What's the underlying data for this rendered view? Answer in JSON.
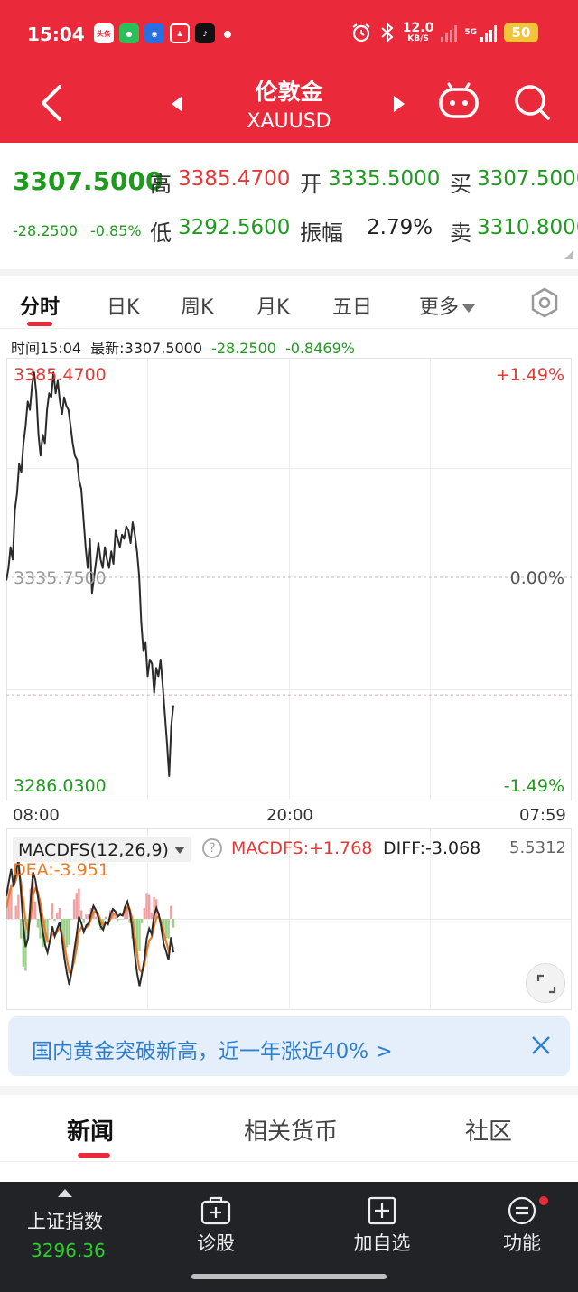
{
  "status": {
    "time": "15:04",
    "net_speed_value": "12.0",
    "net_speed_unit": "KB/S",
    "network": "5G",
    "battery": "50",
    "notif_icons": [
      "toutiao-icon",
      "message-icon",
      "bird-app-icon",
      "qq-icon",
      "tiktok-icon"
    ],
    "notif_toutiao_text": "头条"
  },
  "header": {
    "title": "伦敦金",
    "symbol": "XAUUSD"
  },
  "quote": {
    "price": "3307.5000",
    "change": "-28.2500",
    "change_pct": "-0.85%",
    "high_label": "高",
    "high": "3385.4700",
    "low_label": "低",
    "low": "3292.5600",
    "open_label": "开",
    "open": "3335.5000",
    "amp_label": "振幅",
    "amp": "2.79%",
    "buy_label": "买",
    "buy": "3307.5000",
    "sell_label": "卖",
    "sell": "3310.8000"
  },
  "tabs": {
    "items": [
      "分时",
      "日K",
      "周K",
      "月K",
      "五日"
    ],
    "more": "更多",
    "active": "分时"
  },
  "chart_info": {
    "time": "时间15:04",
    "latest": "最新:3307.5000",
    "change": "-28.2500",
    "change_pct": "-0.8469%"
  },
  "chart_data": {
    "type": "line",
    "ylim": [
      3286.03,
      3385.47
    ],
    "y_left_labels": {
      "top": "3385.4700",
      "mid": "3335.7500",
      "bottom": "3286.0300"
    },
    "y_right_labels": {
      "top": "+1.49%",
      "mid": "0.00%",
      "bottom": "-1.49%"
    },
    "x_labels": [
      "08:00",
      "20:00",
      "07:59"
    ],
    "reference": 3335.75,
    "current": 3307.5,
    "series": [
      {
        "values": [
          3335,
          3338,
          3343,
          3340,
          3352,
          3356,
          3363,
          3361,
          3368,
          3372,
          3378,
          3376,
          3382,
          3385,
          3380,
          3370,
          3365,
          3370,
          3368,
          3376,
          3380,
          3379,
          3385,
          3380,
          3383,
          3378,
          3375,
          3379,
          3377,
          3376,
          3372,
          3368,
          3365,
          3364,
          3359,
          3357,
          3350,
          3343,
          3338,
          3345,
          3332,
          3336,
          3340,
          3344,
          3340,
          3338,
          3343,
          3340,
          3338,
          3342,
          3339,
          3347,
          3345,
          3343,
          3346,
          3345,
          3348,
          3347,
          3344,
          3349,
          3346,
          3342,
          3336,
          3325,
          3318,
          3320,
          3312,
          3316,
          3315,
          3308,
          3314,
          3312,
          3316,
          3310,
          3303,
          3296,
          3288,
          3300,
          3305
        ]
      }
    ]
  },
  "macd": {
    "label": "MACDFS(12,26,9)",
    "macdfs": "MACDFS:+1.768",
    "diff": "DIFF:-3.068",
    "dea": "DEA:-3.951",
    "scale_max": "5.5312",
    "diff_series": [
      2.1,
      3.4,
      4.6,
      3.0,
      4.2,
      5.5,
      2.6,
      -0.6,
      -2.6,
      -1.8,
      1.6,
      4.3,
      3.6,
      2.1,
      0.6,
      -1.1,
      -2.4,
      -3.1,
      -2.0,
      -0.7,
      -1.6,
      -0.9,
      -0.3,
      -1.9,
      -3.6,
      -5.0,
      -6.1,
      -4.8,
      -3.0,
      -1.5,
      0.2,
      -0.4,
      -1.2,
      -0.6,
      -0.4,
      0.5,
      1.2,
      0.8,
      0.1,
      -0.7,
      -1.0,
      -0.3,
      -0.5,
      0.4,
      0.9,
      0.7,
      0.2,
      0.4,
      0.3,
      1.1,
      1.6,
      0.7,
      -0.9,
      -3.2,
      -5.0,
      -6.2,
      -5.1,
      -3.8,
      -1.8,
      -0.9,
      -1.4,
      0.3,
      1.0,
      0.4,
      -0.8,
      -2.3,
      -3.0,
      -3.8,
      -1.7,
      -3.1
    ],
    "dea_series": [
      1.0,
      2.0,
      3.0,
      3.0,
      3.6,
      4.4,
      3.5,
      1.6,
      -0.2,
      -1.1,
      0.2,
      2.2,
      2.8,
      2.5,
      1.5,
      0.2,
      -1.1,
      -2.1,
      -2.0,
      -1.4,
      -1.5,
      -1.2,
      -0.8,
      -1.3,
      -2.4,
      -3.7,
      -4.9,
      -4.8,
      -3.9,
      -2.7,
      -1.2,
      -0.8,
      -1.0,
      -0.8,
      -0.6,
      0.0,
      0.6,
      0.7,
      0.4,
      -0.2,
      -0.6,
      -0.4,
      -0.5,
      0.0,
      0.4,
      0.5,
      0.3,
      0.4,
      0.3,
      0.7,
      1.1,
      0.9,
      0.0,
      -1.6,
      -3.3,
      -4.7,
      -4.9,
      -4.3,
      -3.0,
      -2.0,
      -1.7,
      -0.7,
      0.1,
      0.2,
      -0.3,
      -1.3,
      -2.1,
      -2.9,
      -2.3,
      -2.7
    ]
  },
  "banner": {
    "text": "国内黄金突破新高，近一年涨近40% >"
  },
  "bottom_tabs": {
    "items": [
      "新闻",
      "相关货币",
      "社区"
    ],
    "active": "新闻"
  },
  "footer": {
    "index_name": "上证指数",
    "index_value": "3296.36",
    "diagnose": "诊股",
    "add_watch": "加自选",
    "functions": "功能"
  },
  "colors": {
    "brand_red": "#ea2a3a",
    "up": "#e53935",
    "down": "#1f9a1f",
    "dea": "#f07a24",
    "banner_text": "#2f7fd0"
  }
}
